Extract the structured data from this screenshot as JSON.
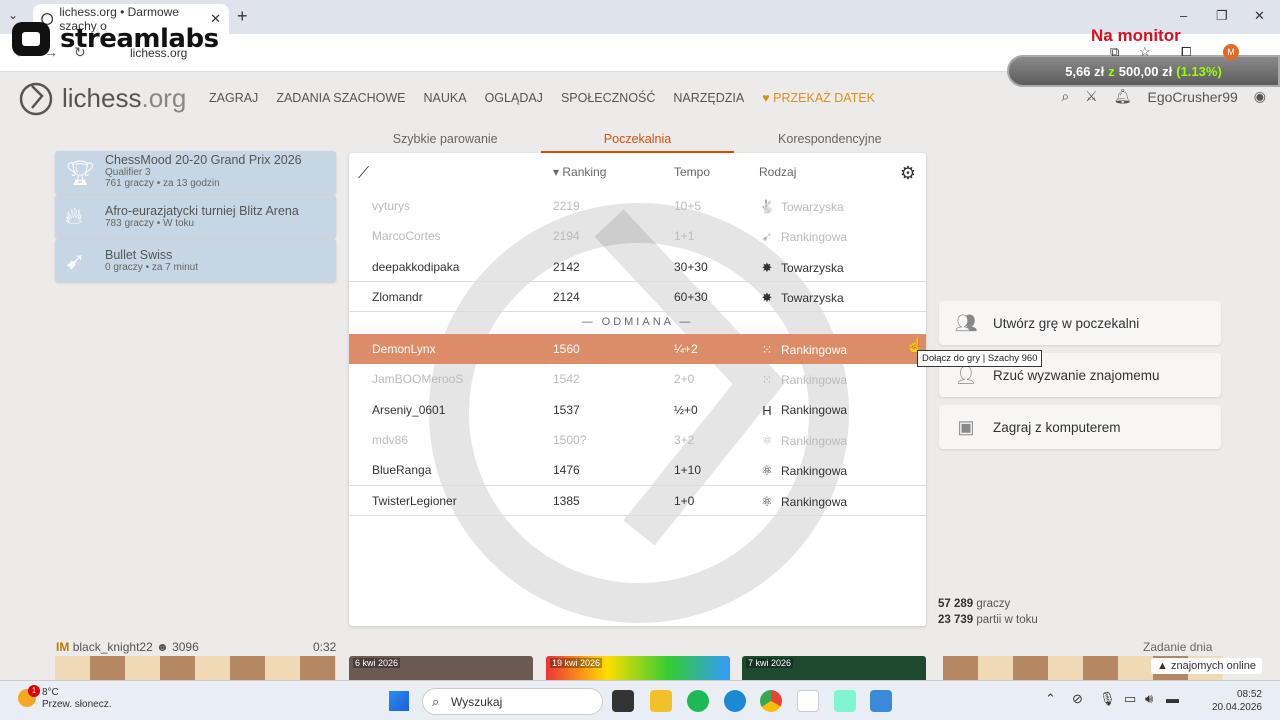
{
  "browser": {
    "tab_title": "lichess.org • Darmowe szachy o",
    "url": "lichess.org",
    "new_tab": "+",
    "minimize": "–",
    "maximize": "❐",
    "close": "✕"
  },
  "overlay": {
    "brand": "streamlabs",
    "donation_title": "Na monitor",
    "donation_current": "5,66 zł",
    "donation_sep": "z",
    "donation_goal": "500,00 zł",
    "donation_pct": "(1.13%)"
  },
  "header": {
    "logo_main": "lichess",
    "logo_org": ".org",
    "nav": [
      "ZAGRAJ",
      "ZADANIA SZACHOWE",
      "NAUKA",
      "OGLĄDAJ",
      "SPOŁECZNOŚĆ",
      "NARZĘDZIA"
    ],
    "donate": "PRZEKAŻ DATEK",
    "username": "EgoCrusher99"
  },
  "lobby_tabs": [
    "Szybkie parowanie",
    "Poczekalnia",
    "Korespondencyjne"
  ],
  "tournaments": [
    {
      "title": "ChessMood 20-20 Grand Prix 2026",
      "subtitle": "Qualifier 3",
      "info": "761 graczy • za 13 godzin",
      "icon": "trophy-icon"
    },
    {
      "title": "Afro-eurazjatycki turniej Blitz Arena",
      "subtitle": "",
      "info": "783 graczy • W toku",
      "icon": "fire-icon"
    },
    {
      "title": "Bullet Swiss",
      "subtitle": "",
      "info": "0 graczy • za 7 minut",
      "icon": "bullet-icon"
    }
  ],
  "hooks": {
    "headers": {
      "rating": "Ranking",
      "time": "Tempo",
      "mode": "Rodzaj"
    },
    "divider": "— ODMIANA —",
    "rows_top": [
      {
        "player": "vyturys",
        "rating": "2219",
        "time": "10+5",
        "mode": "Towarzyska",
        "icon": "🐇",
        "faded": true
      },
      {
        "player": "MarcoCortes",
        "rating": "2194",
        "time": "1+1",
        "mode": "Rankingowa",
        "icon": "➹",
        "faded": true
      },
      {
        "player": "deepakkodipaka",
        "rating": "2142",
        "time": "30+30",
        "mode": "Towarzyska",
        "icon": "✸",
        "faded": false
      },
      {
        "player": "Zlomandr",
        "rating": "2124",
        "time": "60+30",
        "mode": "Towarzyska",
        "icon": "✸",
        "faded": false
      }
    ],
    "rows_variant": [
      {
        "player": "DemonLynx",
        "rating": "1560",
        "time": "¼+2",
        "mode": "Rankingowa",
        "icon": "⁙"
      },
      {
        "player": "JamBOOMerooS",
        "rating": "1542",
        "time": "2+0",
        "mode": "Rankingowa",
        "icon": "⁙"
      },
      {
        "player": "Arseniy_0601",
        "rating": "1537",
        "time": "½+0",
        "mode": "Rankingowa",
        "icon": "H"
      },
      {
        "player": "mdv86",
        "rating": "1500?",
        "time": "3+2",
        "mode": "Rankingowa",
        "icon": "⚛"
      },
      {
        "player": "BlueRanga",
        "rating": "1476",
        "time": "1+10",
        "mode": "Rankingowa",
        "icon": "⚛"
      },
      {
        "player": "TwisterLegioner",
        "rating": "1385",
        "time": "1+0",
        "mode": "Rankingowa",
        "icon": "⚛"
      }
    ],
    "tooltip": "Dołącz do gry | Szachy 960"
  },
  "actions": [
    "Utwórz grę w poczekalni",
    "Rzuć wyzwanie znajomemu",
    "Zagraj z komputerem"
  ],
  "counters": {
    "players_num": "57 289",
    "players_label": "graczy",
    "games_num": "23 739",
    "games_label": "partii w toku"
  },
  "bottom": {
    "title_badge": "IM",
    "streamer": "black_knight22",
    "streamer_rating": "3096",
    "clock": "0:32",
    "blog_dates": [
      "6 kwi 2026",
      "19 kwi 2026",
      "7 kwi 2026"
    ],
    "puzzle_title": "Zadanie dnia",
    "friends": "znajomych online"
  },
  "taskbar": {
    "temp": "8°C",
    "weather": "Przew. słonecz.",
    "badge": "1",
    "search": "Wyszukaj",
    "time": "08:52",
    "date": "20.04.2026"
  },
  "colors": {
    "accent": "#d85000",
    "highlight_row": "#dc8d67",
    "donate": "#d59120"
  }
}
